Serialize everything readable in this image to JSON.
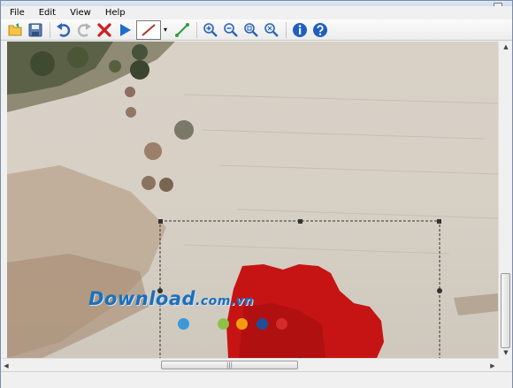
{
  "menu": [
    "File",
    "Edit",
    "View",
    "Help"
  ],
  "toolbar": {
    "buttons": [
      "open-icon",
      "save-icon",
      "undo-icon",
      "redo-icon",
      "delete-icon",
      "run-icon",
      "line-tool-icon",
      "dropdown-icon",
      "segment-tool-icon",
      "zoom-in-icon",
      "zoom-out-icon",
      "zoom-fit-icon",
      "zoom-actual-icon",
      "info-icon",
      "help-icon"
    ]
  },
  "watermark": {
    "text": "Download",
    "suffix": ".com.vn"
  },
  "colors": {
    "selection": "#c61414",
    "dots": [
      "#3a9ad9",
      "#8bc34a",
      "#f39c12",
      "#1f4e9a",
      "#d62b2b"
    ]
  },
  "scroll": {
    "vertical_position": 0.75,
    "horizontal_position": 0.33
  }
}
